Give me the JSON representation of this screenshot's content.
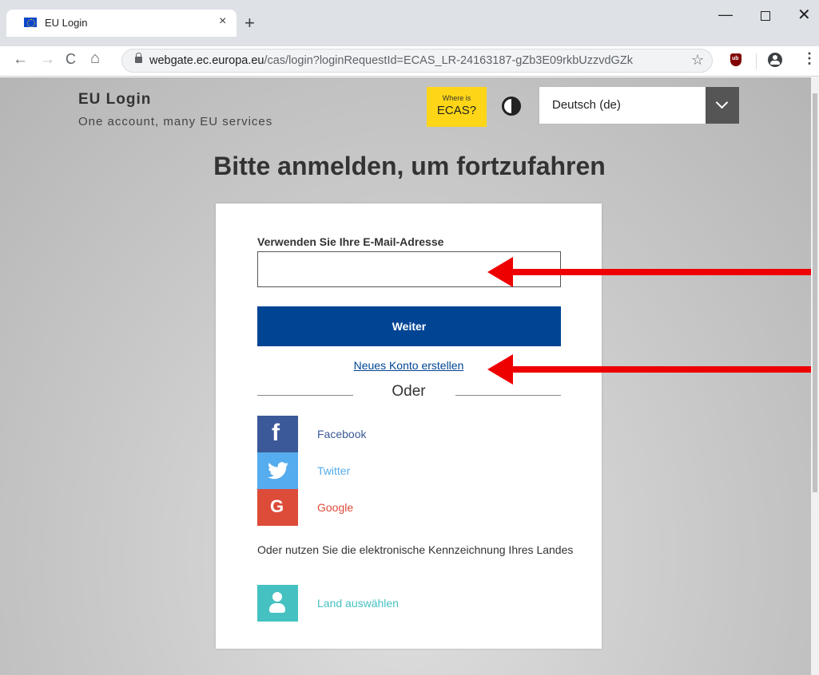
{
  "browser": {
    "tab_title": "EU Login",
    "tab_close": "×",
    "new_tab": "+",
    "window_minimize": "—",
    "window_close": "✕",
    "url_host": "webgate.ec.europa.eu",
    "url_path": "/cas/login?loginRequestId=ECAS_LR-24163187-gZb3E09rkbUzzvdGZk",
    "nav_back": "←",
    "nav_forward": "→",
    "nav_reload": "C",
    "nav_home": "⌂",
    "bookmark_star": "☆",
    "menu": "⋮"
  },
  "header": {
    "brand_title": "EU Login",
    "brand_subtitle": "One account, many EU services",
    "ecas_badge_line1": "Where is",
    "ecas_badge_line2": "ECAS?",
    "language_selected": "Deutsch (de)"
  },
  "main": {
    "page_title": "Bitte anmelden, um fortzufahren",
    "email_label": "Verwenden Sie Ihre E-Mail-Adresse",
    "email_value": "",
    "continue_label": "Weiter",
    "create_account_link": "Neues Konto erstellen",
    "or_text": "Oder",
    "social": {
      "facebook": "Facebook",
      "twitter": "Twitter",
      "google": "Google"
    },
    "eid_text": "Oder nutzen Sie die elektronische Kennzeichnung Ihres Landes",
    "country_label": "Land auswählen"
  },
  "colors": {
    "primary_button": "#004494",
    "ecas_badge": "#ffd617",
    "facebook": "#3b5998",
    "twitter": "#55acee",
    "google": "#dd4b39",
    "eid": "#46c1c1",
    "annotation_arrow": "#ee0000"
  },
  "icons": [
    "lock-icon",
    "star-icon",
    "ublock-icon",
    "profile-icon",
    "contrast-icon",
    "chevron-down-icon",
    "facebook-icon",
    "twitter-icon",
    "google-icon",
    "user-icon"
  ]
}
